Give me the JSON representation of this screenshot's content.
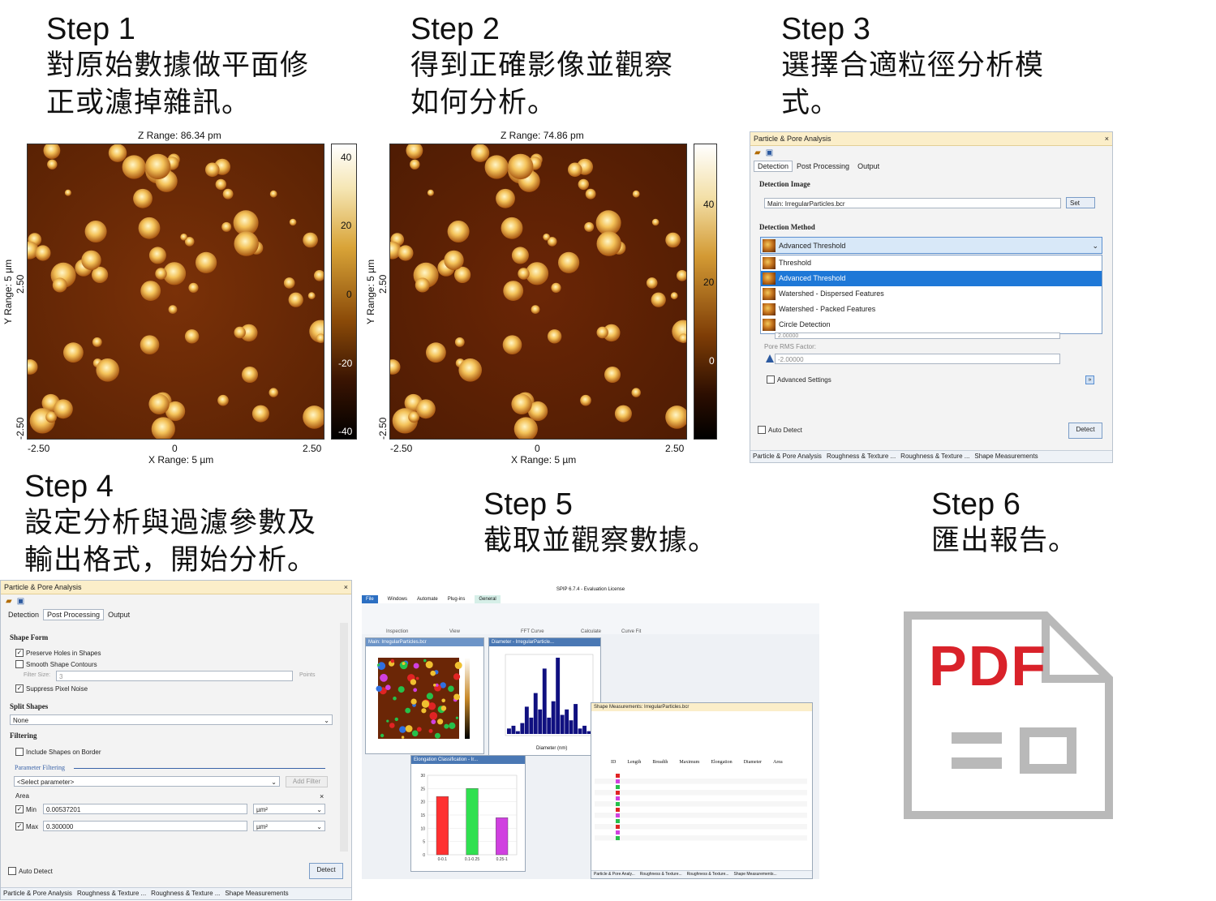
{
  "steps": [
    {
      "num": "Step 1",
      "desc": "對原始數據做平面修\n正或濾掉雜訊。"
    },
    {
      "num": "Step 2",
      "desc": "得到正確影像並觀察\n如何分析。"
    },
    {
      "num": "Step 3",
      "desc": "選擇合適粒徑分析模\n式。"
    },
    {
      "num": "Step 4",
      "desc": "設定分析與過濾參數及\n輸出格式，開始分析。"
    },
    {
      "num": "Step 5",
      "desc": "截取並觀察數據。"
    },
    {
      "num": "Step 6",
      "desc": "匯出報告。"
    }
  ],
  "afm1": {
    "z_range": "Z Range: 86.34 pm",
    "y_label": "Y Range: 5 µm",
    "x_label": "X Range: 5 µm",
    "x_ticks": [
      "-2.50",
      "0",
      "2.50"
    ],
    "y_ticks": [
      "2.50",
      "0",
      "-2.50"
    ],
    "bar_ticks": [
      "40",
      "20",
      "0",
      "-20",
      "-40"
    ]
  },
  "afm2": {
    "z_range": "Z Range: 74.86 pm",
    "y_label": "Y Range: 5 µm",
    "x_label": "X Range: 5 µm",
    "x_ticks": [
      "-2.50",
      "0",
      "2.50"
    ],
    "y_ticks": [
      "2.50",
      "0",
      "-2.50"
    ],
    "bar_ticks": [
      "40",
      "20",
      "0"
    ]
  },
  "panel3": {
    "title": "Particle & Pore Analysis",
    "close": "×",
    "tabs": [
      "Detection",
      "Post Processing",
      "Output"
    ],
    "detection_image_label": "Detection Image",
    "detection_image_value": "Main: IrregularParticles.bcr",
    "set_button": "Set",
    "detection_method_label": "Detection Method",
    "selected_method": "Advanced Threshold",
    "options": [
      "Threshold",
      "Advanced Threshold",
      "Watershed - Dispersed Features",
      "Watershed - Packed Features",
      "Circle Detection"
    ],
    "hidden_value": "2.00000",
    "pore_rms_label": "Pore RMS Factor:",
    "pore_rms_value": "-2.00000",
    "advanced_settings": "Advanced Settings",
    "auto_detect": "Auto Detect",
    "detect_button": "Detect",
    "bottom_tabs": [
      "Particle & Pore Analysis",
      "Roughness & Texture ...",
      "Roughness & Texture ...",
      "Shape Measurements"
    ]
  },
  "panel4": {
    "title": "Particle & Pore Analysis",
    "close": "×",
    "tabs": [
      "Detection",
      "Post Processing",
      "Output"
    ],
    "shape_form": "Shape Form",
    "preserve_holes": "Preserve Holes in Shapes",
    "smooth_contours": "Smooth Shape Contours",
    "filter_size_label": "Filter Size:",
    "filter_size_value": "3",
    "filter_size_unit": "Points",
    "suppress_noise": "Suppress Pixel Noise",
    "split_shapes": "Split Shapes",
    "split_value": "None",
    "filtering": "Filtering",
    "include_border": "Include Shapes on Border",
    "parameter_filtering": "Parameter Filtering",
    "select_parameter": "<Select parameter>",
    "add_filter": "Add Filter",
    "area_label": "Area",
    "min_label": "Min",
    "min_value": "0.00537201",
    "max_label": "Max",
    "max_value": "0.300000",
    "unit": "µm²",
    "auto_detect": "Auto Detect",
    "detect_button": "Detect",
    "bottom_tabs": [
      "Particle & Pore Analysis",
      "Roughness & Texture ...",
      "Roughness & Texture ...",
      "Shape Measurements"
    ]
  },
  "panel5": {
    "app_title": "SPIP 6.7.4 - Evaluation License",
    "ribbon_tabs": [
      "File",
      "Windows",
      "Automate",
      "Plug-ins",
      "General"
    ],
    "ribbon_groups": [
      "Inspection",
      "View",
      "FFT Curve",
      "Calculate",
      "Curve Fit"
    ],
    "main_window": "Main: IrregularParticles.bcr",
    "diameter_window": "Diameter - IrregularParticle...",
    "elongation_window": "Elongation Classification - Ir...",
    "shape_window": "Shape Measurements: IrregularParticles.bcr",
    "diameter_xlabel": "Diameter (nm)",
    "elongation_bars": [
      {
        "label": "0-0.1",
        "value": 22,
        "color": "#ff3030"
      },
      {
        "label": "0.1-0.25",
        "value": 25,
        "color": "#30e050"
      },
      {
        "label": "0.25-1",
        "value": 14,
        "color": "#d040e0"
      }
    ],
    "elongation_ylim": [
      0,
      30
    ],
    "histogram_values": [
      2,
      3,
      1,
      4,
      10,
      6,
      15,
      9,
      24,
      6,
      12,
      28,
      7,
      9,
      5,
      11,
      2,
      3,
      1
    ],
    "table_headers": [
      "ID",
      "Length",
      "Breadth",
      "Maximum",
      "Elongation",
      "Diameter",
      "Area"
    ],
    "bottom_tabs": [
      "Particle & Pore Analy...",
      "Roughness & Texture...",
      "Roughness & Texture...",
      "Shape Measurements..."
    ]
  },
  "pdf_icon": {
    "label": "PDF"
  }
}
